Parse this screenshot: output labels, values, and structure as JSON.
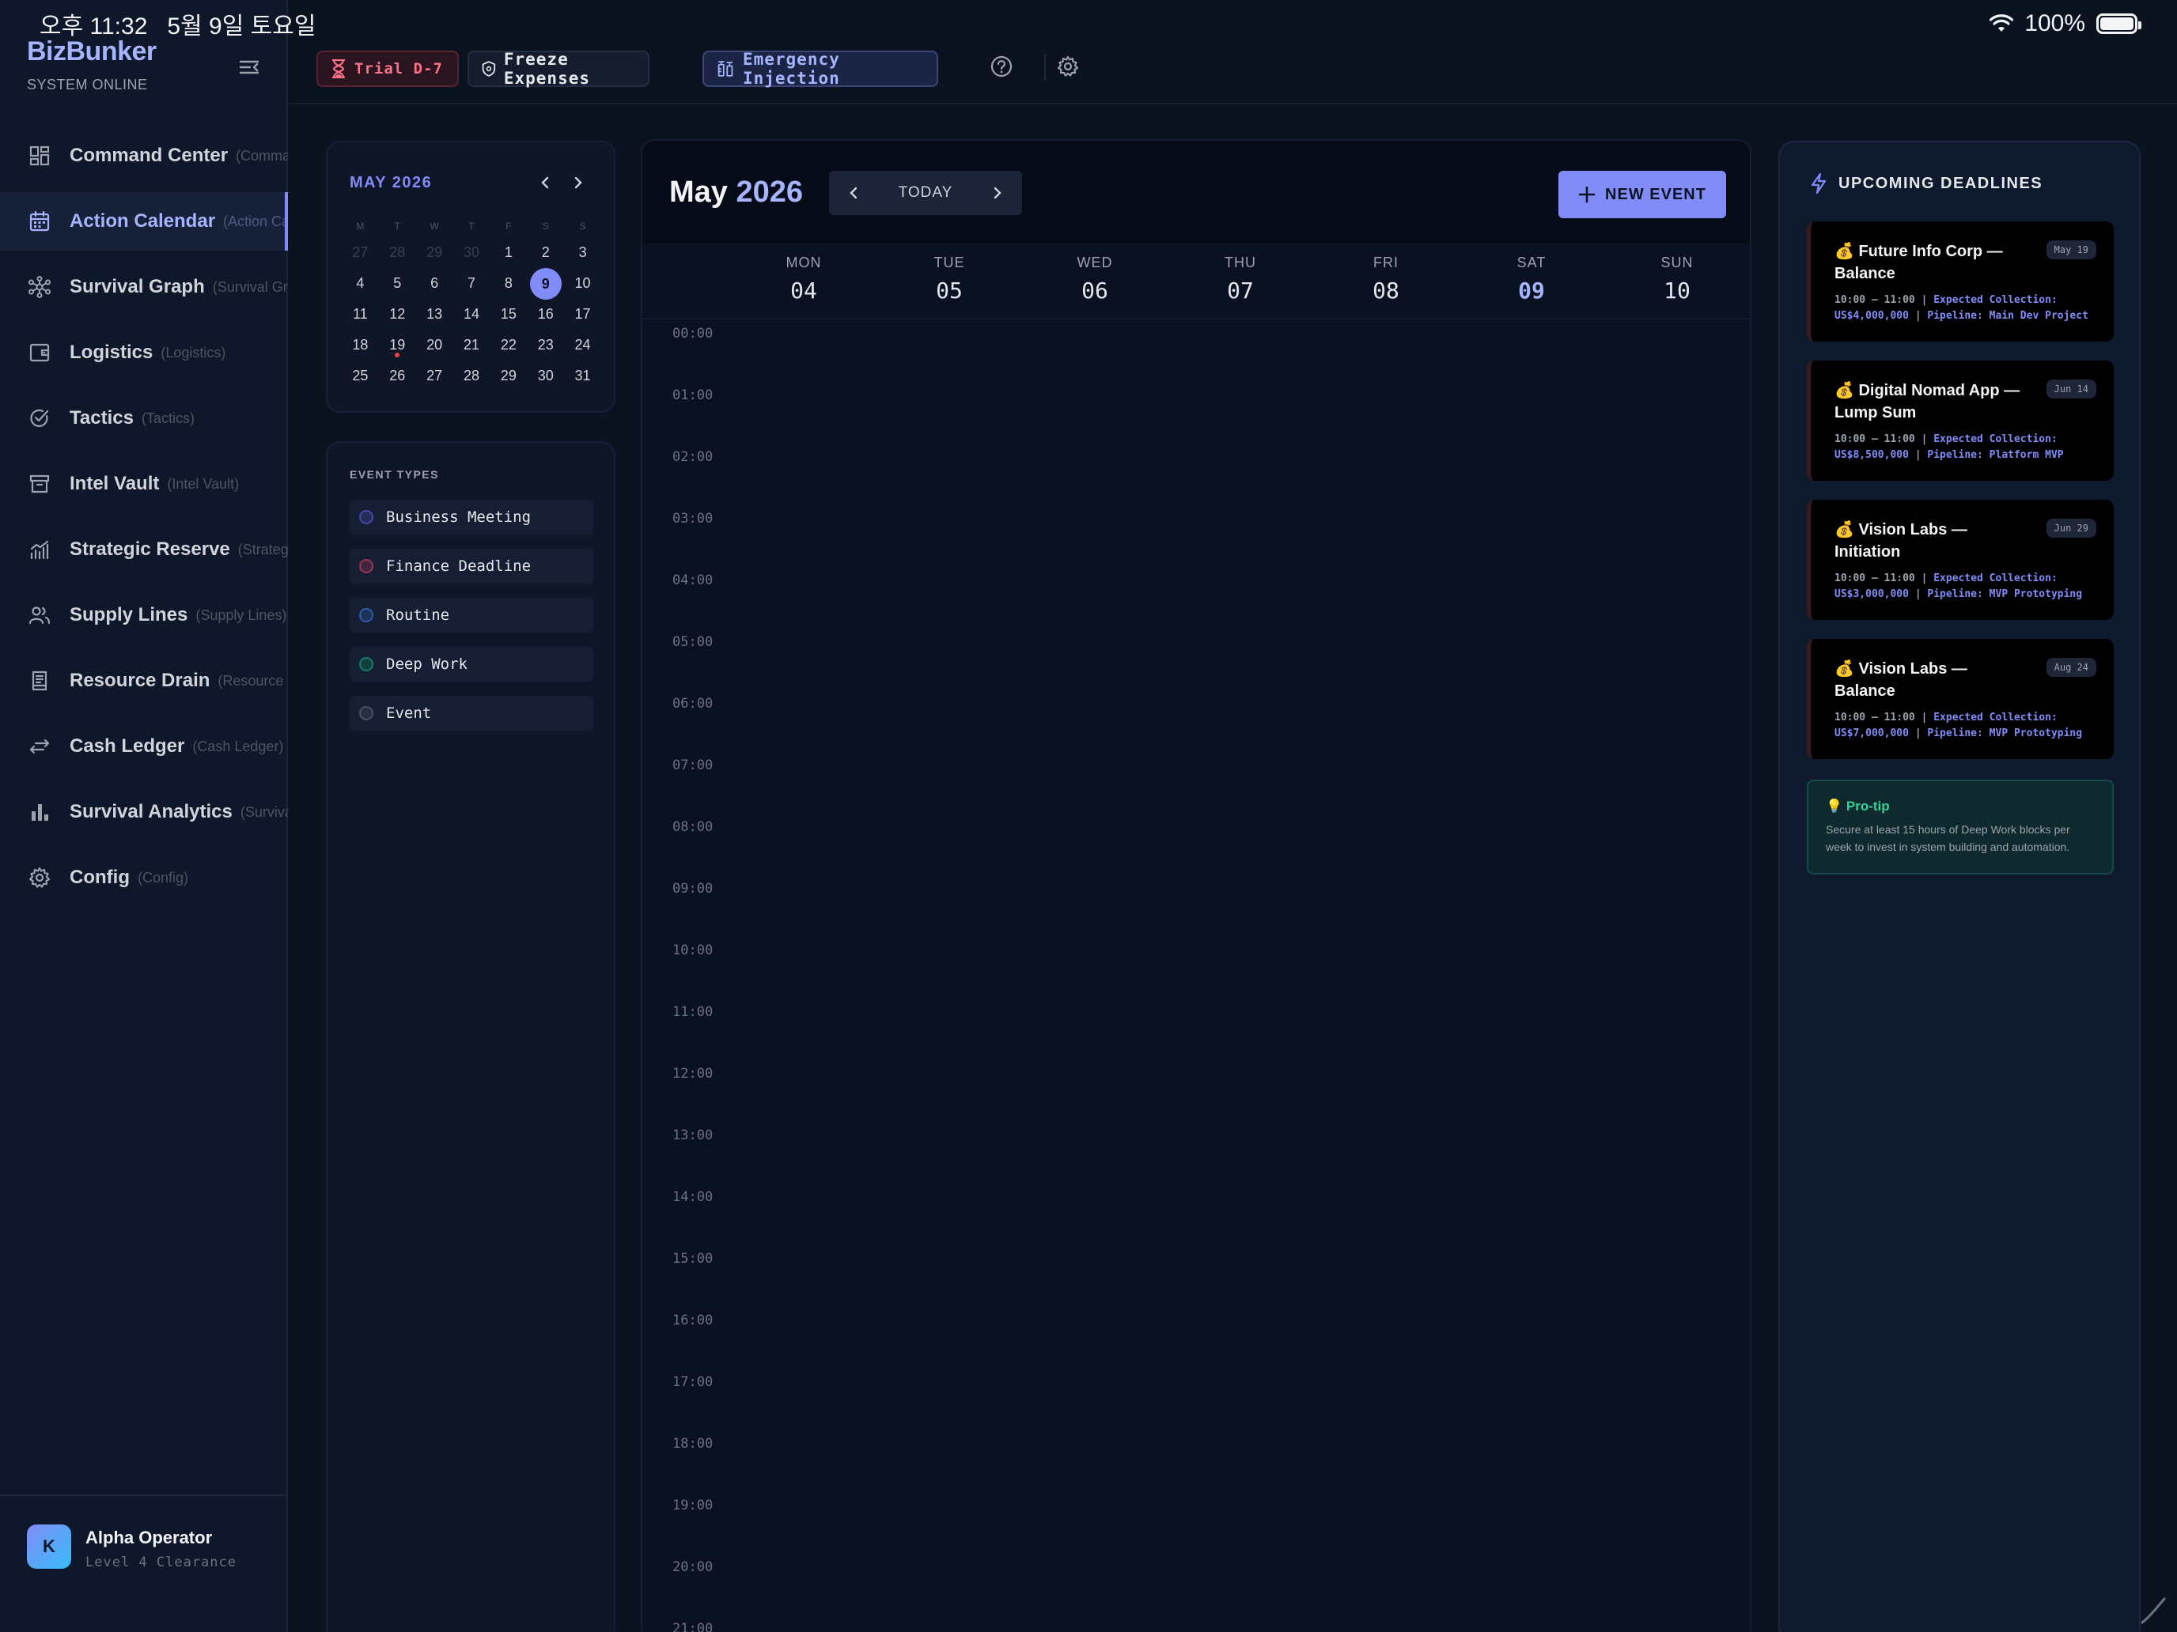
{
  "status_bar": {
    "time": "오후 11:32",
    "date": "5월 9일 토요일",
    "battery": "100%"
  },
  "sidebar": {
    "brand": "BizBunker",
    "status": "SYSTEM ONLINE",
    "items": [
      {
        "label": "Command Center",
        "sub": "(Command Center)",
        "icon": "grid-icon"
      },
      {
        "label": "Action Calendar",
        "sub": "(Action Calendar)",
        "icon": "calendar-icon",
        "active": true
      },
      {
        "label": "Survival Graph",
        "sub": "(Survival Graph)",
        "icon": "graph-icon"
      },
      {
        "label": "Logistics",
        "sub": "(Logistics)",
        "icon": "wallet-icon"
      },
      {
        "label": "Tactics",
        "sub": "(Tactics)",
        "icon": "check-circle-icon"
      },
      {
        "label": "Intel Vault",
        "sub": "(Intel Vault)",
        "icon": "archive-icon"
      },
      {
        "label": "Strategic Reserve",
        "sub": "(Strategic Reserve)",
        "icon": "trend-chart-icon"
      },
      {
        "label": "Supply Lines",
        "sub": "(Supply Lines)",
        "icon": "users-icon"
      },
      {
        "label": "Resource Drain",
        "sub": "(Resource Drain)",
        "icon": "receipt-icon"
      },
      {
        "label": "Cash Ledger",
        "sub": "(Cash Ledger)",
        "icon": "transfer-icon"
      },
      {
        "label": "Survival Analytics",
        "sub": "(Survival Analytics)",
        "icon": "bar-chart-icon"
      },
      {
        "label": "Config",
        "sub": "(Config)",
        "icon": "gear-icon"
      }
    ],
    "user": {
      "initial": "K",
      "name": "Alpha Operator",
      "level": "Level 4 Clearance"
    }
  },
  "toolbar": {
    "trial": "Trial D-7",
    "freeze": "Freeze Expenses",
    "emergency": "Emergency Injection"
  },
  "mini_calendar": {
    "title": "MAY 2026",
    "weekdays": [
      "M",
      "T",
      "W",
      "T",
      "F",
      "S",
      "S"
    ],
    "days": [
      {
        "d": "27",
        "muted": true
      },
      {
        "d": "28",
        "muted": true
      },
      {
        "d": "29",
        "muted": true
      },
      {
        "d": "30",
        "muted": true
      },
      {
        "d": "1"
      },
      {
        "d": "2"
      },
      {
        "d": "3"
      },
      {
        "d": "4"
      },
      {
        "d": "5"
      },
      {
        "d": "6"
      },
      {
        "d": "7"
      },
      {
        "d": "8"
      },
      {
        "d": "9",
        "today": true
      },
      {
        "d": "10"
      },
      {
        "d": "11"
      },
      {
        "d": "12"
      },
      {
        "d": "13"
      },
      {
        "d": "14"
      },
      {
        "d": "15"
      },
      {
        "d": "16"
      },
      {
        "d": "17"
      },
      {
        "d": "18"
      },
      {
        "d": "19",
        "dot": true
      },
      {
        "d": "20"
      },
      {
        "d": "21"
      },
      {
        "d": "22"
      },
      {
        "d": "23"
      },
      {
        "d": "24"
      },
      {
        "d": "25"
      },
      {
        "d": "26"
      },
      {
        "d": "27"
      },
      {
        "d": "28"
      },
      {
        "d": "29"
      },
      {
        "d": "30"
      },
      {
        "d": "31"
      }
    ]
  },
  "event_types": {
    "title": "EVENT TYPES",
    "items": [
      {
        "label": "Business Meeting",
        "color": "#6366f1"
      },
      {
        "label": "Finance Deadline",
        "color": "#f43f5e"
      },
      {
        "label": "Routine",
        "color": "#3b82f6"
      },
      {
        "label": "Deep Work",
        "color": "#10b981"
      },
      {
        "label": "Event",
        "color": "#64748b"
      }
    ]
  },
  "calendar": {
    "month": "May",
    "year": "2026",
    "today_label": "TODAY",
    "new_event_label": "NEW EVENT",
    "days": [
      {
        "name": "MON",
        "date": "04"
      },
      {
        "name": "TUE",
        "date": "05"
      },
      {
        "name": "WED",
        "date": "06"
      },
      {
        "name": "THU",
        "date": "07"
      },
      {
        "name": "FRI",
        "date": "08"
      },
      {
        "name": "SAT",
        "date": "09",
        "selected": true
      },
      {
        "name": "SUN",
        "date": "10"
      }
    ],
    "hours": [
      "00:00",
      "01:00",
      "02:00",
      "03:00",
      "04:00",
      "05:00",
      "06:00",
      "07:00",
      "08:00",
      "09:00",
      "10:00",
      "11:00",
      "12:00",
      "13:00",
      "14:00",
      "15:00",
      "16:00",
      "17:00",
      "18:00",
      "19:00",
      "20:00",
      "21:00"
    ]
  },
  "deadlines": {
    "title": "UPCOMING DEADLINES",
    "items": [
      {
        "name": "💰 Future Info Corp — Balance",
        "date": "May 19",
        "time": "10:00 – 11:00",
        "collection": "Expected Collection: US$4,000,000",
        "pipeline": "Pipeline: Main Dev Project"
      },
      {
        "name": "💰 Digital Nomad App — Lump Sum",
        "date": "Jun 14",
        "time": "10:00 – 11:00",
        "collection": "Expected Collection: US$8,500,000",
        "pipeline": "Pipeline: Platform MVP"
      },
      {
        "name": "💰 Vision Labs — Initiation",
        "date": "Jun 29",
        "time": "10:00 – 11:00",
        "collection": "Expected Collection: US$3,000,000",
        "pipeline": "Pipeline: MVP Prototyping"
      },
      {
        "name": "💰 Vision Labs — Balance",
        "date": "Aug 24",
        "time": "10:00 – 11:00",
        "collection": "Expected Collection: US$7,000,000",
        "pipeline": "Pipeline: MVP Prototyping"
      }
    ],
    "protip_title": "💡 Pro-tip",
    "protip_text": "Secure at least 15 hours of Deep Work blocks per week to invest in system building and automation."
  }
}
